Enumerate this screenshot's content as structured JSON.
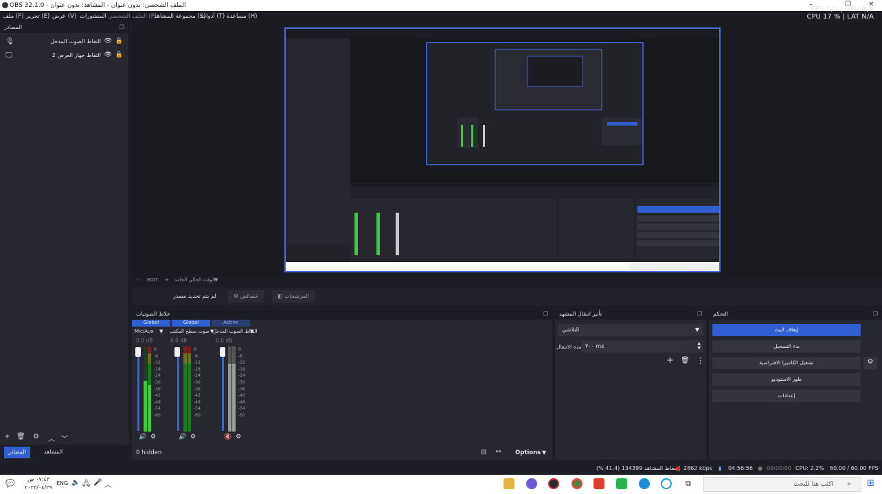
{
  "window": {
    "title": "OBS 32.1.0 - الملف الشخصي: بدون عنوان - المشاهد: بدون عنوان",
    "min": "–",
    "max": "❐",
    "close": "✕"
  },
  "menu": {
    "items": [
      "ملف (F)",
      "تحرير (E)",
      "عرض (V)",
      "المنشورات",
      "الملف الشخصي (P)",
      "مجموعة المشاهد (S)",
      "أدوات (T)",
      "مساعدة (H)"
    ]
  },
  "stats_top": {
    "fps": "FPS N/A | GPU N/A",
    "cpu": "CPU 17 % | LAT N/A"
  },
  "sources": {
    "title": "المصادر",
    "float_icon": "❐",
    "items": [
      {
        "label": "التقاط الصوت المدخل",
        "type_icon": "🎙"
      },
      {
        "label": "التقاط جهاز العرض 2",
        "type_icon": "🖵"
      }
    ],
    "toolbar": {
      "add": "+",
      "remove": "🗑",
      "settings": "⚙",
      "up": "︿",
      "down": "﹀"
    }
  },
  "tabs": {
    "sources": "المصادر",
    "scenes": "المشاهد"
  },
  "scene_bar": {
    "item1": "EDIT",
    "item2": "الوقت الحالي الجامد"
  },
  "context": {
    "no_source": "لم يتم تحديد مصدر",
    "properties": "خصائص",
    "filters": "المرشحات"
  },
  "mixer": {
    "title": "خلاط الصوتيات",
    "channels": [
      {
        "mode": "Global",
        "name": "Mic/Aux",
        "db": "0.0 dB"
      },
      {
        "mode": "Global",
        "name": "صوت سطح المكتب",
        "db": "0.0 dB"
      },
      {
        "mode": "Active",
        "name": "التقاط الصوت المدخل",
        "db": "0.0 dB"
      }
    ],
    "ticks": [
      "0",
      "-6",
      "-12",
      "-18",
      "-24",
      "-30",
      "-36",
      "-42",
      "-48",
      "-54",
      "-60"
    ],
    "hidden": "0 hidden",
    "options": "Options"
  },
  "transitions": {
    "title": "تأثير انتقال المشهد",
    "selected": "التلاشي",
    "duration_label": "مدة الانتقال",
    "duration_value": "٣٠٠ ms"
  },
  "controls": {
    "title": "التحكم",
    "stop_stream": "إيقاف البث",
    "start_record": "بدء التسجيل",
    "virtual_cam": "تشغيل الكاميرا الافتراضية",
    "studio_mode": "طور الاستوديو",
    "settings": "إعدادات"
  },
  "status": {
    "dropped": "إسقاط المشاهد 134399 (41.4 %)",
    "kbps": "2862 kbps",
    "stream_time": "04:56:56",
    "rec_time": "00:00:00",
    "cpu": "CPU: 2.2%",
    "fps": "60.00 / 60.00 FPS"
  },
  "taskbar": {
    "time": "٠٧:٤٣ ص",
    "date": "٢٠٢٣/٠٤/٢٩",
    "lang": "ENG",
    "search_placeholder": "اكتب هنا للبحث"
  }
}
